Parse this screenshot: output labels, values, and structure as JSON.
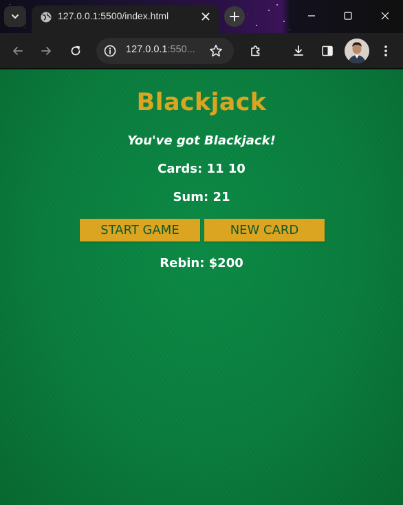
{
  "browser": {
    "tab": {
      "title": "127.0.0.1:5500/index.html"
    },
    "address_bar": {
      "host": "127.0.0.1",
      "rest": ":550..."
    },
    "icons": [
      "tab-search-icon",
      "globe-icon",
      "close-icon",
      "plus-icon",
      "minimize-icon",
      "maximize-icon",
      "window-close-icon",
      "back-icon",
      "forward-icon",
      "reload-icon",
      "info-icon",
      "star-icon",
      "extensions-icon",
      "download-icon",
      "side-panel-icon",
      "profile-avatar",
      "menu-icon"
    ]
  },
  "game": {
    "title": "Blackjack",
    "message": "You've got Blackjack!",
    "cards_text": "Cards: 11 10",
    "sum_text": "Sum: 21",
    "start_button": "START GAME",
    "new_card_button": "NEW CARD",
    "player_text": "Rebin: $200",
    "colors": {
      "table_green": "#0a7c3d",
      "accent_gold": "#dca521",
      "button_text": "#0d5a2a"
    }
  }
}
